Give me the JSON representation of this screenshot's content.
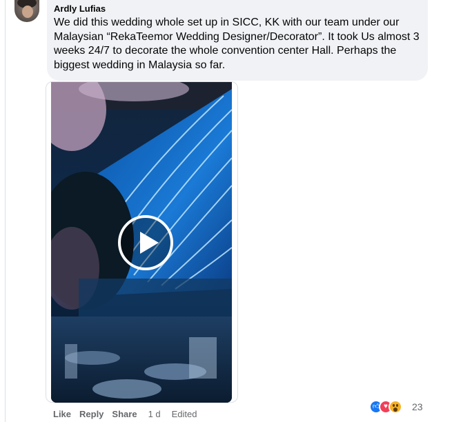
{
  "comment": {
    "author": "Ardly Lufias",
    "text": "We did this wedding whole set up in SICC, KK with our team under our Malaysian “RekaTeemor Wedding Designer/Decorator”. It took Us almost 3 weeks 24/7 to decorate the whole convention center Hall. Perhaps the biggest wedding in Malaysia so far."
  },
  "video": {
    "play_icon": "play-icon"
  },
  "actions": {
    "like": "Like",
    "reply": "Reply",
    "share": "Share",
    "time": "1 d",
    "edited": "Edited"
  },
  "reactions": {
    "icons": [
      "like-reaction-icon",
      "love-reaction-icon",
      "wow-reaction-icon"
    ],
    "count": "23"
  },
  "colors": {
    "bubble": "#f0f2f5",
    "secondary_text": "#65676b",
    "like_blue": "#1877f2",
    "love_red": "#f33e58",
    "wow_yellow": "#f7b125"
  }
}
